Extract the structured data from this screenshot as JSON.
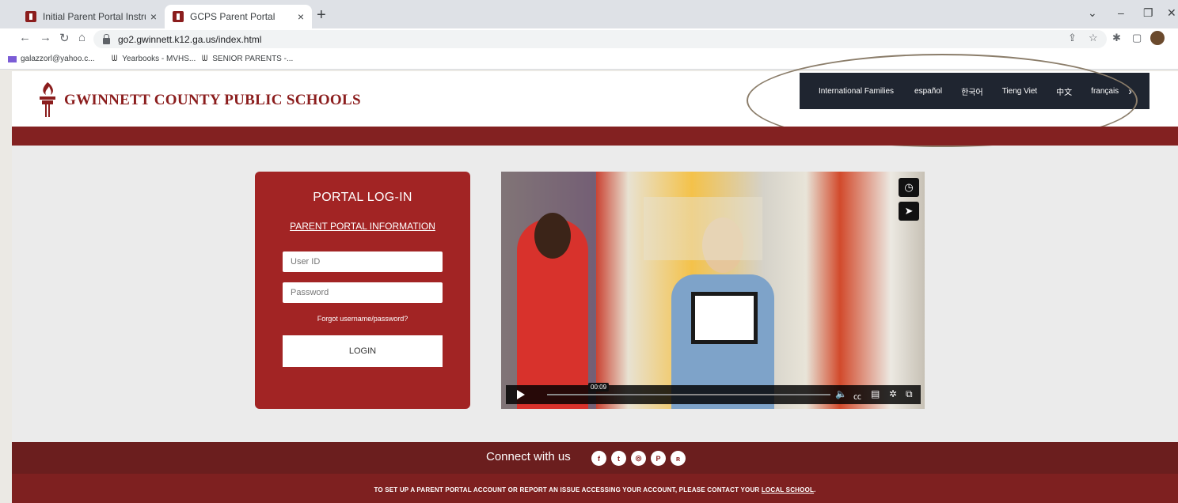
{
  "browser": {
    "tabs": [
      {
        "title": "Initial Parent Portal Instructions /",
        "close": "×"
      },
      {
        "title": "GCPS Parent Portal",
        "close": "×"
      }
    ],
    "new_tab": "+",
    "window_controls": [
      "⌄",
      "–",
      "❐",
      "✕"
    ],
    "url": "go2.gwinnett.k12.ga.us/index.html",
    "bookmarks": [
      {
        "label": "galazzorl@yahoo.c...",
        "icon": "mail-icon"
      },
      {
        "label": "Yearbooks - MVHS...",
        "icon": "w-icon"
      },
      {
        "label": "SENIOR PARENTS -...",
        "icon": "w-icon"
      }
    ]
  },
  "site": {
    "title": "GWINNETT COUNTY PUBLIC SCHOOLS",
    "languages": [
      "International Families",
      "español",
      "한국어",
      "Tieng Viet",
      "中文",
      "français"
    ],
    "lang_next": "›"
  },
  "login": {
    "title": "PORTAL LOG-IN",
    "info_link": "PARENT PORTAL INFORMATION",
    "userid_placeholder": "User ID",
    "password_placeholder": "Password",
    "forgot": "Forgot username/password?",
    "button": "LOGIN"
  },
  "video": {
    "timestamp": "00:09",
    "controls": [
      "play-icon",
      "volume-icon",
      "captions-icon",
      "transcript-icon",
      "settings-icon",
      "fullscreen-icon"
    ]
  },
  "footer": {
    "connect": "Connect with us",
    "social": [
      "facebook",
      "twitter",
      "instagram",
      "pinterest",
      "rss"
    ],
    "notice": "TO SET UP A PARENT PORTAL ACCOUNT OR REPORT AN ISSUE ACCESSING YOUR ACCOUNT, PLEASE CONTACT YOUR",
    "notice_link": "LOCAL SCHOOL",
    "notice_end": "."
  },
  "colors": {
    "brand_red": "#a22424",
    "dark_red": "#6b1e1e",
    "lang_bar": "#1f2530"
  }
}
